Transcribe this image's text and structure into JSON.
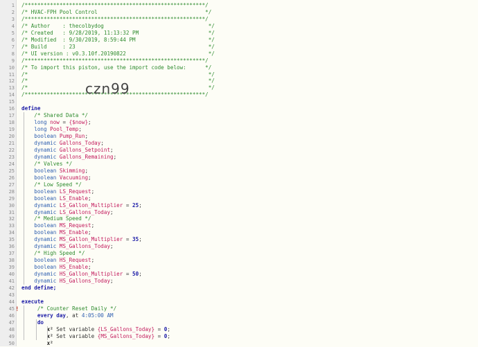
{
  "editor": {
    "import_code": "czn99",
    "lines": [
      [
        {
          "t": "/*********************************************************/",
          "s": "c"
        }
      ],
      [
        {
          "t": "/* HVAC-FPH Pool Control                                  */",
          "s": "c"
        }
      ],
      [
        {
          "t": "/*********************************************************/",
          "s": "c"
        }
      ],
      [
        {
          "t": "/* Author    : thecolbydog                                 */",
          "s": "c"
        }
      ],
      [
        {
          "t": "/* Created   : 9/28/2019, 11:13:32 PM                      */",
          "s": "c"
        }
      ],
      [
        {
          "t": "/* Modified  : 9/30/2019, 8:59:44 PM                       */",
          "s": "c"
        }
      ],
      [
        {
          "t": "/* Build     : 23                                          */",
          "s": "c"
        }
      ],
      [
        {
          "t": "/* UI version : v0.3.10f.20190822                          */",
          "s": "c"
        }
      ],
      [
        {
          "t": "/*********************************************************/",
          "s": "c"
        }
      ],
      [
        {
          "t": "/* To import this piston, use the import code below:      */",
          "s": "c"
        }
      ],
      [
        {
          "t": "/*                                                         */",
          "s": "c"
        }
      ],
      [
        {
          "t": "/*                                                         */",
          "s": "c"
        }
      ],
      [
        {
          "t": "/*                                                         */",
          "s": "c"
        }
      ],
      [
        {
          "t": "/*********************************************************/",
          "s": "c"
        }
      ],
      [],
      [
        {
          "t": "define",
          "s": "k"
        }
      ],
      [
        {
          "t": "    /* Shared Data */",
          "s": "c"
        }
      ],
      [
        {
          "t": "    long ",
          "s": "t"
        },
        {
          "t": "now",
          "s": "v"
        },
        {
          "t": " = ",
          "s": "p"
        },
        {
          "t": "{$now}",
          "s": "f"
        },
        {
          "t": ";",
          "s": "p"
        }
      ],
      [
        {
          "t": "    long ",
          "s": "t"
        },
        {
          "t": "Pool_Temp",
          "s": "v"
        },
        {
          "t": ";",
          "s": "p"
        }
      ],
      [
        {
          "t": "    boolean ",
          "s": "t"
        },
        {
          "t": "Pump_Run",
          "s": "v"
        },
        {
          "t": ";",
          "s": "p"
        }
      ],
      [
        {
          "t": "    dynamic ",
          "s": "t"
        },
        {
          "t": "Gallons_Today",
          "s": "v"
        },
        {
          "t": ";",
          "s": "p"
        }
      ],
      [
        {
          "t": "    dynamic ",
          "s": "t"
        },
        {
          "t": "Gallons_Setpoint",
          "s": "v"
        },
        {
          "t": ";",
          "s": "p"
        }
      ],
      [
        {
          "t": "    dynamic ",
          "s": "t"
        },
        {
          "t": "Gallons_Remaining",
          "s": "v"
        },
        {
          "t": ";",
          "s": "p"
        }
      ],
      [
        {
          "t": "    /* Valves */",
          "s": "c"
        }
      ],
      [
        {
          "t": "    boolean ",
          "s": "t"
        },
        {
          "t": "Skimming",
          "s": "v"
        },
        {
          "t": ";",
          "s": "p"
        }
      ],
      [
        {
          "t": "    boolean ",
          "s": "t"
        },
        {
          "t": "Vacuuming",
          "s": "v"
        },
        {
          "t": ";",
          "s": "p"
        }
      ],
      [
        {
          "t": "    /* Low Speed */",
          "s": "c"
        }
      ],
      [
        {
          "t": "    boolean ",
          "s": "t"
        },
        {
          "t": "LS_Request",
          "s": "v"
        },
        {
          "t": ";",
          "s": "p"
        }
      ],
      [
        {
          "t": "    boolean ",
          "s": "t"
        },
        {
          "t": "LS_Enable",
          "s": "v"
        },
        {
          "t": ";",
          "s": "p"
        }
      ],
      [
        {
          "t": "    dynamic ",
          "s": "t"
        },
        {
          "t": "LS_Gallon_Multiplier",
          "s": "v"
        },
        {
          "t": " = ",
          "s": "p"
        },
        {
          "t": "25",
          "s": "n"
        },
        {
          "t": ";",
          "s": "p"
        }
      ],
      [
        {
          "t": "    dynamic ",
          "s": "t"
        },
        {
          "t": "LS_Gallons_Today",
          "s": "v"
        },
        {
          "t": ";",
          "s": "p"
        }
      ],
      [
        {
          "t": "    /* Medium Speed */",
          "s": "c"
        }
      ],
      [
        {
          "t": "    boolean ",
          "s": "t"
        },
        {
          "t": "MS_Request",
          "s": "v"
        },
        {
          "t": ";",
          "s": "p"
        }
      ],
      [
        {
          "t": "    boolean ",
          "s": "t"
        },
        {
          "t": "MS_Enable",
          "s": "v"
        },
        {
          "t": ";",
          "s": "p"
        }
      ],
      [
        {
          "t": "    dynamic ",
          "s": "t"
        },
        {
          "t": "MS_Gallon_Multiplier",
          "s": "v"
        },
        {
          "t": " = ",
          "s": "p"
        },
        {
          "t": "35",
          "s": "n"
        },
        {
          "t": ";",
          "s": "p"
        }
      ],
      [
        {
          "t": "    dynamic ",
          "s": "t"
        },
        {
          "t": "MS_Gallons_Today",
          "s": "v"
        },
        {
          "t": ";",
          "s": "p"
        }
      ],
      [
        {
          "t": "    /* High Speed */",
          "s": "c"
        }
      ],
      [
        {
          "t": "    boolean ",
          "s": "t"
        },
        {
          "t": "HS_Request",
          "s": "v"
        },
        {
          "t": ";",
          "s": "p"
        }
      ],
      [
        {
          "t": "    boolean ",
          "s": "t"
        },
        {
          "t": "HS_Enable",
          "s": "v"
        },
        {
          "t": ";",
          "s": "p"
        }
      ],
      [
        {
          "t": "    dynamic ",
          "s": "t"
        },
        {
          "t": "HS_Gallon_Multiplier",
          "s": "v"
        },
        {
          "t": " = ",
          "s": "p"
        },
        {
          "t": "50",
          "s": "n"
        },
        {
          "t": ";",
          "s": "p"
        }
      ],
      [
        {
          "t": "    dynamic ",
          "s": "t"
        },
        {
          "t": "HS_Gallons_Today",
          "s": "v"
        },
        {
          "t": ";",
          "s": "p"
        }
      ],
      [
        {
          "t": "end define;",
          "s": "k"
        }
      ],
      [],
      [
        {
          "t": "execute",
          "s": "k"
        }
      ],
      [
        {
          "t": "     /* Counter Reset Daily */",
          "s": "c"
        }
      ],
      [
        {
          "t": "     every day",
          "s": "k"
        },
        {
          "t": ", at ",
          "s": "p"
        },
        {
          "t": "4:05:00 AM",
          "s": "t"
        }
      ],
      [
        {
          "t": "     do",
          "s": "k"
        }
      ],
      [
        {
          "t": "        ",
          "s": "p"
        },
        {
          "t": "x²",
          "s": "x"
        },
        {
          "t": " Set variable ",
          "s": "p"
        },
        {
          "t": "{LS_Gallons_Today}",
          "s": "f"
        },
        {
          "t": " = ",
          "s": "p"
        },
        {
          "t": "0",
          "s": "n"
        },
        {
          "t": ";",
          "s": "p"
        }
      ],
      [
        {
          "t": "        ",
          "s": "p"
        },
        {
          "t": "x²",
          "s": "x"
        },
        {
          "t": " Set variable ",
          "s": "p"
        },
        {
          "t": "{MS_Gallons_Today}",
          "s": "f"
        },
        {
          "t": " = ",
          "s": "p"
        },
        {
          "t": "0",
          "s": "n"
        },
        {
          "t": ";",
          "s": "p"
        }
      ],
      [
        {
          "t": "        ",
          "s": "p"
        },
        {
          "t": "x²",
          "s": "x"
        }
      ]
    ],
    "line_numbers": [
      "1",
      "2",
      "3",
      "4",
      "5",
      "6",
      "7",
      "8",
      "9",
      "10",
      "11",
      "12",
      "13",
      "14",
      "15",
      "16",
      "17",
      "18",
      "19",
      "20",
      "21",
      "22",
      "23",
      "24",
      "25",
      "26",
      "27",
      "28",
      "29",
      "30",
      "31",
      "32",
      "33",
      "34",
      "35",
      "36",
      "37",
      "38",
      "39",
      "40",
      "41",
      "42",
      "43",
      "44",
      "45",
      "46",
      "47",
      "48",
      "49",
      "50"
    ],
    "breakpoint_marker": "!"
  }
}
